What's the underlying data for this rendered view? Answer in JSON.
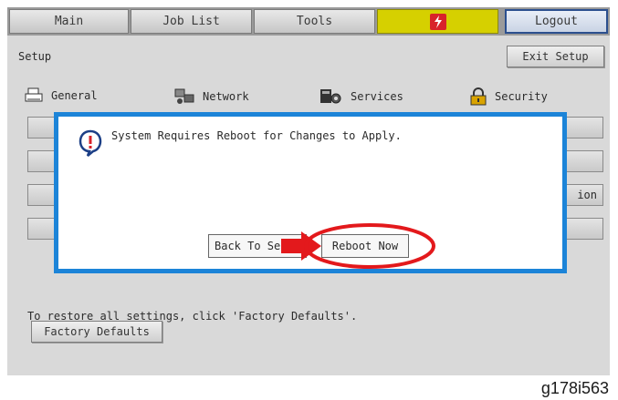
{
  "tabs": [
    {
      "label": "Main"
    },
    {
      "label": "Job List"
    },
    {
      "label": "Tools"
    },
    {
      "label": ""
    },
    {
      "label": "Logout"
    }
  ],
  "fiery_icon_text": "Fiery",
  "setup": {
    "title": "Setup",
    "exit_label": "Exit Setup"
  },
  "categories": [
    {
      "label": "General",
      "icon": "printer-icon"
    },
    {
      "label": "Network",
      "icon": "network-icon"
    },
    {
      "label": "Services",
      "icon": "services-icon"
    },
    {
      "label": "Security",
      "icon": "lock-icon"
    }
  ],
  "background_button_partial": "ion",
  "dialog": {
    "message": "System Requires Reboot for Changes to Apply.",
    "back_label": "Back To Se",
    "reboot_label": "Reboot Now"
  },
  "footer": {
    "restore_text": "To restore all settings, click 'Factory Defaults'.",
    "factory_defaults_label": "Factory Defaults"
  },
  "caption": "g178i563",
  "colors": {
    "dialog_border": "#1c84d8",
    "highlight_red": "#e3191c",
    "fiery_tab": "#d6d000"
  }
}
